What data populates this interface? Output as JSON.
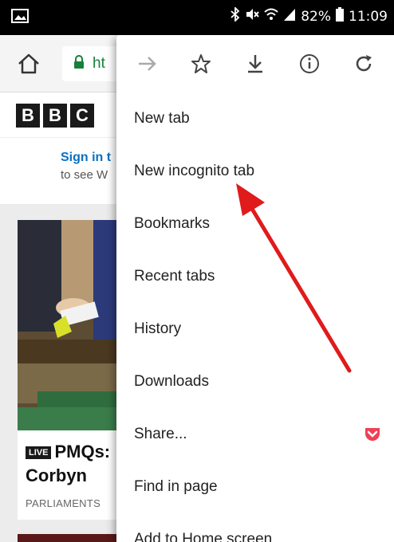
{
  "status_bar": {
    "battery_percent": "82%",
    "time": "11:09",
    "icons": [
      "image-icon",
      "bluetooth-icon",
      "mute-icon",
      "wifi-icon",
      "signal-icon",
      "battery-icon"
    ]
  },
  "toolbar": {
    "url_partial": "ht",
    "icons": [
      "home-icon",
      "lock-icon"
    ]
  },
  "page": {
    "logo_letters": [
      "B",
      "B",
      "C"
    ],
    "signin_link": "Sign in t",
    "signin_sub": "to see W",
    "live_badge": "LIVE",
    "headline_line1": "PMQs:",
    "headline_line2": "Corbyn",
    "headline_tag": "PARLIAMENTS"
  },
  "menu": {
    "icon_row": [
      "forward-icon",
      "bookmark-star-icon",
      "download-icon",
      "info-icon",
      "reload-icon"
    ],
    "items": [
      {
        "label": "New tab"
      },
      {
        "label": "New incognito tab"
      },
      {
        "label": "Bookmarks"
      },
      {
        "label": "Recent tabs"
      },
      {
        "label": "History"
      },
      {
        "label": "Downloads"
      },
      {
        "label": "Share..."
      },
      {
        "label": "Find in page"
      },
      {
        "label": "Add to Home screen"
      }
    ]
  },
  "colors": {
    "menu_bg": "#ffffff",
    "status_bar": "#000000",
    "url_green": "#188038",
    "arrow_red": "#e01b1b",
    "pocket_red": "#ef4056",
    "link_blue": "#0a70c2"
  }
}
